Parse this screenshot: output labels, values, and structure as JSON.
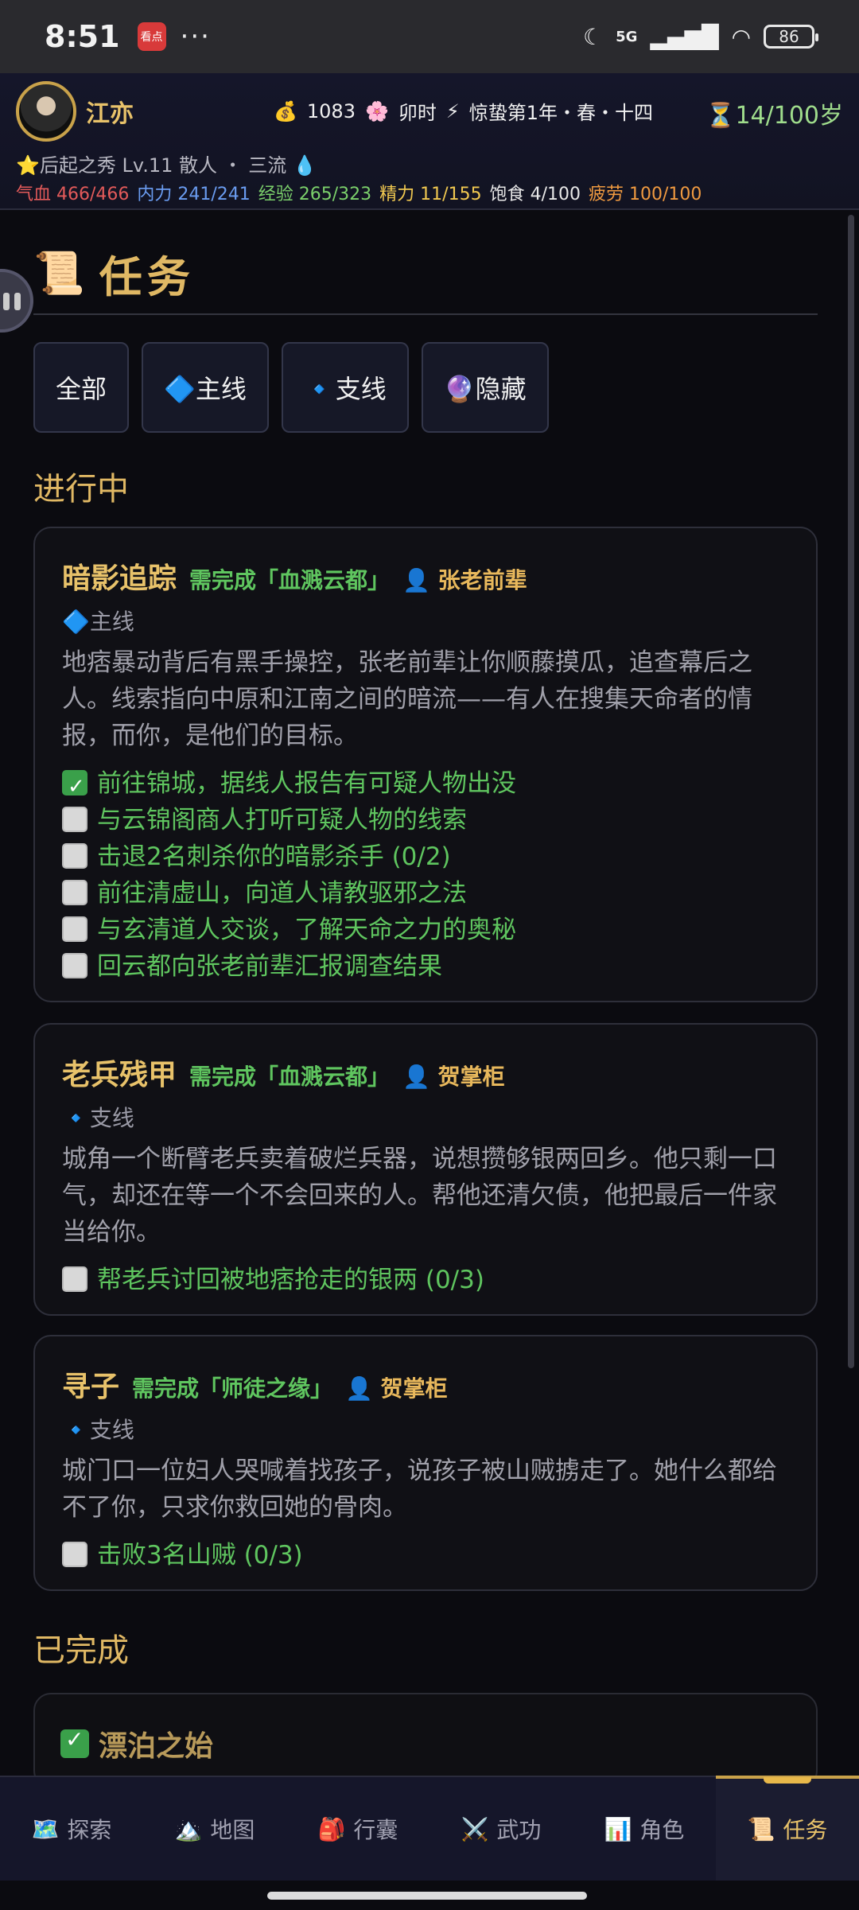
{
  "status_bar": {
    "time": "8:51",
    "app_badge": "看点",
    "dots": "···",
    "net": "5G",
    "battery": "86"
  },
  "player": {
    "name": "江亦",
    "money_icon": "💰",
    "money": "1083",
    "time_icon": "🌸",
    "time_of_day": "卯时",
    "era_icon": "⚡",
    "era": "惊蛰第1年・春・十四",
    "age_icon": "⏳",
    "age": "14/100岁",
    "title_star": "⭐",
    "title": "后起之秀 Lv.11 散人 ・ 三流",
    "title_drop": "💧",
    "stats": {
      "hp": "气血 466/466",
      "mp": "内力 241/241",
      "exp": "经验 265/323",
      "energy": "精力 11/155",
      "food": "饱食 4/100",
      "fatigue": "疲劳 100/100"
    }
  },
  "page": {
    "icon": "📜",
    "title": "任务"
  },
  "filters": [
    {
      "label": "全部"
    },
    {
      "label": "🔷主线"
    },
    {
      "label": "🔹支线"
    },
    {
      "label": "🔮隐藏"
    }
  ],
  "sections": {
    "in_progress": "进行中",
    "completed": "已完成"
  },
  "quests": [
    {
      "title": "暗影追踪",
      "requirement": "需完成「血溅云都」",
      "npc": "👤 张老前辈",
      "type": "🔷主线",
      "description": "地痞暴动背后有黑手操控，张老前辈让你顺藤摸瓜，追查幕后之人。线索指向中原和江南之间的暗流——有人在搜集天命者的情报，而你，是他们的目标。",
      "objectives": [
        {
          "text": "前往锦城，据线人报告有可疑人物出没",
          "done": true
        },
        {
          "text": "与云锦阁商人打听可疑人物的线索",
          "done": false
        },
        {
          "text": "击退2名刺杀你的暗影杀手 (0/2)",
          "done": false
        },
        {
          "text": "前往清虚山，向道人请教驱邪之法",
          "done": false
        },
        {
          "text": "与玄清道人交谈，了解天命之力的奥秘",
          "done": false
        },
        {
          "text": "回云都向张老前辈汇报调查结果",
          "done": false
        }
      ]
    },
    {
      "title": "老兵残甲",
      "requirement": "需完成「血溅云都」",
      "npc": "👤 贺掌柜",
      "type": "🔹支线",
      "description": "城角一个断臂老兵卖着破烂兵器，说想攒够银两回乡。他只剩一口气，却还在等一个不会回来的人。帮他还清欠债，他把最后一件家当给你。",
      "objectives": [
        {
          "text": "帮老兵讨回被地痞抢走的银两 (0/3)",
          "done": false
        }
      ]
    },
    {
      "title": "寻子",
      "requirement": "需完成「师徒之缘」",
      "npc": "👤 贺掌柜",
      "type": "🔹支线",
      "description": "城门口一位妇人哭喊着找孩子，说孩子被山贼掳走了。她什么都给不了你，只求你救回她的骨肉。",
      "objectives": [
        {
          "text": "击败3名山贼 (0/3)",
          "done": false
        }
      ]
    }
  ],
  "completed_quests": [
    {
      "title": "漂泊之始"
    }
  ],
  "nav": [
    {
      "icon": "🗺️",
      "label": "探索",
      "active": false
    },
    {
      "icon": "🏔️",
      "label": "地图",
      "active": false
    },
    {
      "icon": "🎒",
      "label": "行囊",
      "active": false
    },
    {
      "icon": "⚔️",
      "label": "武功",
      "active": false
    },
    {
      "icon": "📊",
      "label": "角色",
      "active": false
    },
    {
      "icon": "📜",
      "label": "任务",
      "active": true
    }
  ]
}
